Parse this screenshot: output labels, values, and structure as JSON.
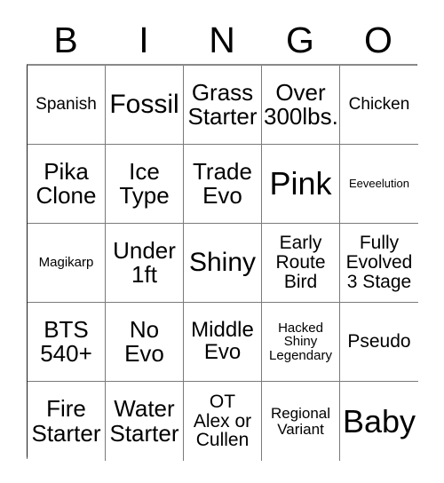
{
  "card": {
    "header_letters": [
      "B",
      "I",
      "N",
      "G",
      "O"
    ],
    "text_color": "#000000",
    "background_color": "#ffffff",
    "grid_line_color": "#7a7a7a",
    "rows": [
      [
        {
          "text": "Spanish",
          "size": "fs-m"
        },
        {
          "text": "Fossil",
          "size": "fs-2xl"
        },
        {
          "text": "Grass\nStarter",
          "size": "fs-xl"
        },
        {
          "text": "Over\n300lbs.",
          "size": "fs-xl"
        },
        {
          "text": "Chicken",
          "size": "fs-m"
        }
      ],
      [
        {
          "text": "Pika\nClone",
          "size": "fs-xl"
        },
        {
          "text": "Ice\nType",
          "size": "fs-xl"
        },
        {
          "text": "Trade\nEvo",
          "size": "fs-xl"
        },
        {
          "text": "Pink",
          "size": "fs-3xl"
        },
        {
          "text": "Eeveelution",
          "size": "fs-xs"
        }
      ],
      [
        {
          "text": "Magikarp",
          "size": "fs-s"
        },
        {
          "text": "Under\n1ft",
          "size": "fs-xl"
        },
        {
          "text": "Shiny",
          "size": "fs-2xl"
        },
        {
          "text": "Early\nRoute\nBird",
          "size": "fs-ml"
        },
        {
          "text": "Fully\nEvolved\n3 Stage",
          "size": "fs-ml"
        }
      ],
      [
        {
          "text": "BTS\n540+",
          "size": "fs-xl"
        },
        {
          "text": "No\nEvo",
          "size": "fs-xl"
        },
        {
          "text": "Middle\nEvo",
          "size": "fs-l"
        },
        {
          "text": "Hacked\nShiny\nLegendary",
          "size": "fs-s"
        },
        {
          "text": "Pseudo",
          "size": "fs-ml"
        }
      ],
      [
        {
          "text": "Fire\nStarter",
          "size": "fs-xl"
        },
        {
          "text": "Water\nStarter",
          "size": "fs-xl"
        },
        {
          "text": "OT\nAlex or\nCullen",
          "size": "fs-ml"
        },
        {
          "text": "Regional\nVariant",
          "size": "fs-sm"
        },
        {
          "text": "Baby",
          "size": "fs-3xl"
        }
      ]
    ]
  }
}
